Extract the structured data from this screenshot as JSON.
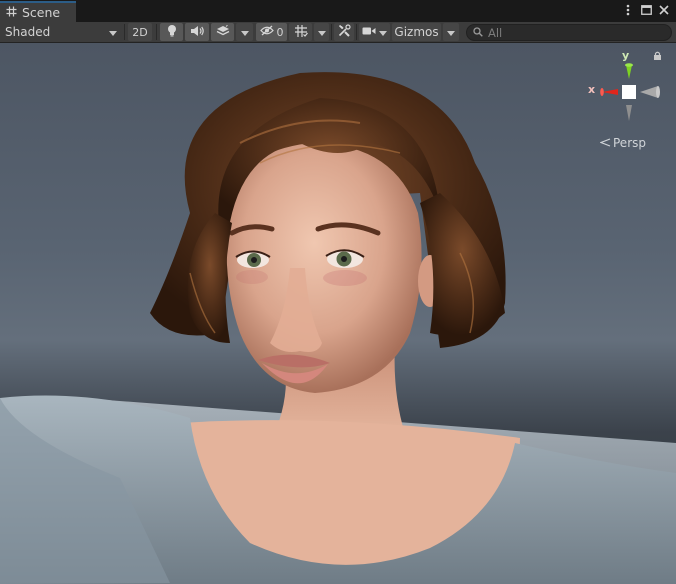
{
  "tab": {
    "label": "Scene",
    "icon": "grid-icon"
  },
  "window_controls": [
    "kebab-menu-icon",
    "maximize-icon",
    "close-icon"
  ],
  "toolbar": {
    "draw_mode": "Shaded",
    "mode_2d": "2D",
    "hidden_count": "0",
    "gizmos": "Gizmos",
    "search_placeholder": "All"
  },
  "orientation_gizmo": {
    "y_label": "y",
    "x_label": "x",
    "projection": "Persp",
    "colors": {
      "x": "#e0261c",
      "y": "#7ed321",
      "z": "#a9a9a9"
    }
  }
}
